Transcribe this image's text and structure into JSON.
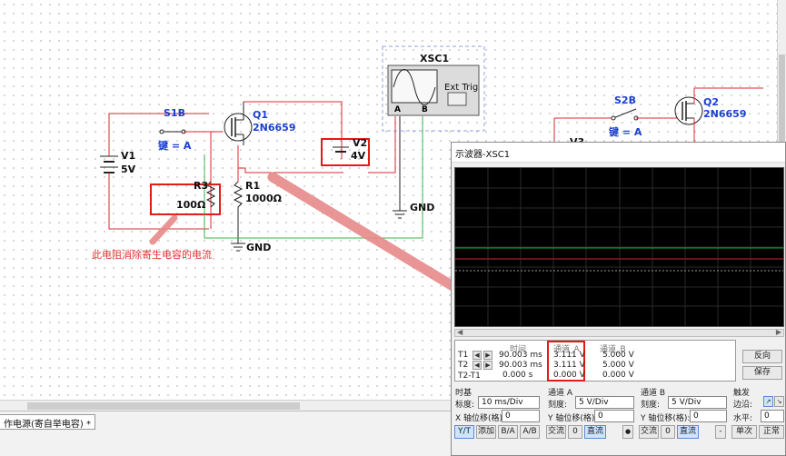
{
  "schematic": {
    "s1b_label": "S1B",
    "s1b_key": "键 = A",
    "q1_name": "Q1",
    "q1_model": "2N6659",
    "v1_name": "V1",
    "v1_value": "5V",
    "r3_name": "R3",
    "r3_value": "100Ω",
    "r1_name": "R1",
    "r1_value": "1000Ω",
    "gnd1": "GND",
    "gnd2": "GND",
    "v2_name": "V2",
    "v2_value": "4V",
    "xsc_name": "XSC1",
    "ext_trig": "Ext Trig",
    "ch_a": "A",
    "ch_b": "B",
    "s2b_label": "S2B",
    "s2b_key": "键 = A",
    "q2_name": "Q2",
    "q2_model": "2N6659",
    "v3_name": "V3",
    "annotation": "此电阻消除寄生电容的电流"
  },
  "bottom_tab": "作电源(寄自举电容) *",
  "scope": {
    "title": "示波器-XSC1",
    "readout": {
      "hdr_time": "时间",
      "hdr_a": "通道_A",
      "hdr_b": "通道_B",
      "rows": [
        {
          "label": "T1",
          "time": "90.003 ms",
          "a": "3.111 V",
          "b": "5.000 V"
        },
        {
          "label": "T2",
          "time": "90.003 ms",
          "a": "3.111 V",
          "b": "5.000 V"
        },
        {
          "label": "T2-T1",
          "time": "0.000 s",
          "a": "0.000 V",
          "b": "0.000 V"
        }
      ],
      "reverse_btn": "反向",
      "save_btn": "保存"
    },
    "timebase": {
      "title": "时基",
      "scale_label": "标度:",
      "scale_value": "10 ms/Div",
      "xpos_label": "X 轴位移(格):",
      "xpos_value": "0",
      "modes": [
        "Y/T",
        "添加",
        "B/A",
        "A/B"
      ]
    },
    "channel_a": {
      "title": "通道 A",
      "scale_label": "刻度:",
      "scale_value": "5  V/Div",
      "ypos_label": "Y 轴位移(格):",
      "ypos_value": "0",
      "coupling": [
        "交流",
        "0",
        "直流"
      ]
    },
    "channel_b": {
      "title": "通道 B",
      "scale_label": "刻度:",
      "scale_value": "5  V/Div",
      "ypos_label": "Y 轴位移(格):",
      "ypos_value": "0",
      "coupling": [
        "交流",
        "0",
        "直流",
        "-"
      ]
    },
    "trigger": {
      "title": "触发",
      "edge_label": "边沿:",
      "level_label": "水平:",
      "level_value": "0",
      "modes": [
        "单次",
        "正常"
      ]
    }
  },
  "colors": {
    "wire_red": "#d8282f",
    "wire_green": "#3cb34a",
    "trace_green": "#16a34a",
    "trace_red": "#8a1a1a",
    "highlight": "#e21b1b"
  }
}
